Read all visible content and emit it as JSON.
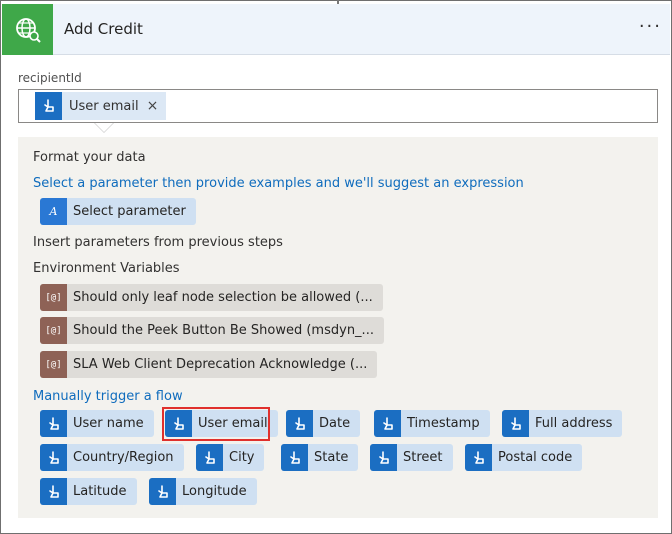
{
  "header": {
    "title": "Add Credit",
    "more_label": "···",
    "icon": "globe-search-icon"
  },
  "recipient": {
    "label": "recipientId",
    "token_label": "User email",
    "remove_label": "×"
  },
  "dropdown": {
    "format_heading": "Format your data",
    "select_param_link": "Select a parameter then provide examples and we'll suggest an expression",
    "select_param_button": "Select parameter",
    "insert_heading": "Insert parameters from previous steps",
    "env_heading": "Environment Variables",
    "env_icon_text": "[@]",
    "env_items": [
      "Should only leaf node selection be allowed (...",
      "Should the Peek Button Be Showed (msdyn_...",
      "SLA Web Client Deprecation Acknowledge (..."
    ],
    "trigger_heading": "Manually trigger a flow",
    "trigger_items": [
      "User name",
      "User email",
      "Date",
      "Timestamp",
      "Full address",
      "Country/Region",
      "City",
      "State",
      "Street",
      "Postal code",
      "Latitude",
      "Longitude"
    ]
  },
  "colors": {
    "accent": "#0f6cbd",
    "app_icon_bg": "#3fa849",
    "token_bg": "#cfe0f2",
    "highlight": "#e0302c"
  }
}
